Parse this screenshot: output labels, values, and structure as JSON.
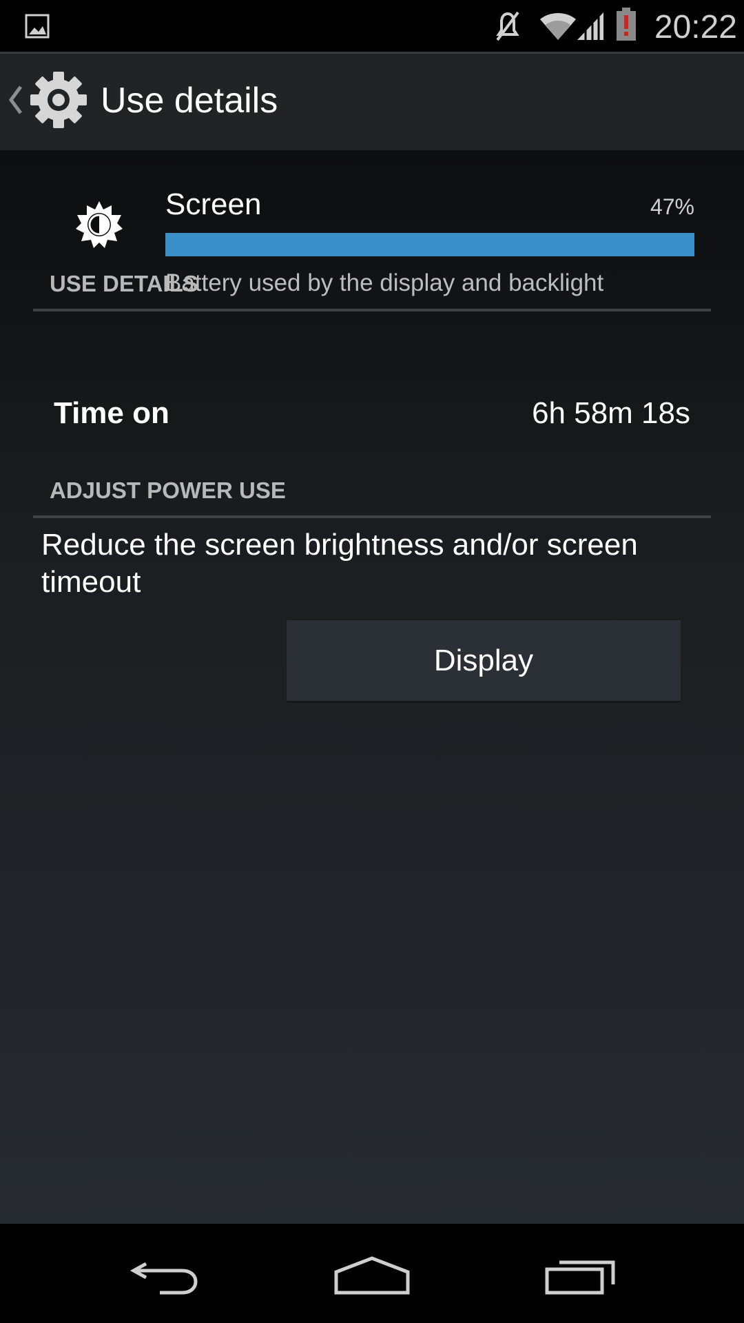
{
  "status_bar": {
    "time": "20:22",
    "icons": [
      "gallery-notification-icon",
      "mute-icon",
      "wifi-icon",
      "signal-icon",
      "battery-low-icon"
    ]
  },
  "action_bar": {
    "title": "Use details",
    "icon": "settings-gear-icon"
  },
  "app_usage": {
    "name": "Screen",
    "icon": "brightness-icon",
    "percent": "47%",
    "percent_value": 47,
    "bar_color": "#3b8fc8",
    "description": "Battery used by the display and backlight"
  },
  "use_details": {
    "header": "USE DETAILS",
    "items": [
      {
        "label": "Time on",
        "value": "6h 58m 18s"
      }
    ]
  },
  "adjust_power": {
    "header": "ADJUST POWER USE",
    "suggestion": "Reduce the screen brightness and/or screen timeout",
    "button_label": "Display"
  },
  "nav_bar": {
    "buttons": [
      "back-icon",
      "home-icon",
      "recents-icon"
    ]
  }
}
